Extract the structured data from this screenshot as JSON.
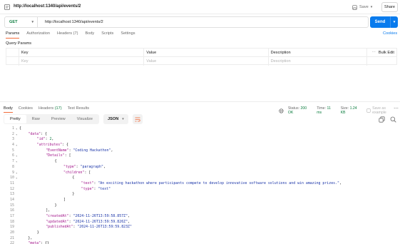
{
  "titlebar": {
    "title": "http://localhost:1340/api/events/2",
    "save_label": "Save",
    "share_label": "Share"
  },
  "request": {
    "method": "GET",
    "url": "http://localhost:1340/api/events/2",
    "send_label": "Send"
  },
  "request_tabs": [
    {
      "label": "Params",
      "active": true
    },
    {
      "label": "Authorization",
      "active": false
    },
    {
      "label": "Headers (7)",
      "active": false
    },
    {
      "label": "Body",
      "active": false
    },
    {
      "label": "Scripts",
      "active": false
    },
    {
      "label": "Settings",
      "active": false
    }
  ],
  "cookies_label": "Cookies",
  "query_params": {
    "title": "Query Params",
    "headers": {
      "key": "Key",
      "value": "Value",
      "description": "Description",
      "bulk_edit": "Bulk Edit"
    },
    "placeholder": {
      "key": "Key",
      "value": "Value",
      "description": "Description"
    }
  },
  "response": {
    "tabs": [
      {
        "label": "Body",
        "active": true
      },
      {
        "label": "Cookies",
        "active": false
      },
      {
        "label": "Headers",
        "count": "(17)",
        "active": false
      },
      {
        "label": "Test Results",
        "active": false
      }
    ],
    "status_label": "Status:",
    "status_value": "200 OK",
    "time_label": "Time:",
    "time_value": "11 ms",
    "size_label": "Size:",
    "size_value": "1.24 KB",
    "save_example": "Save as example"
  },
  "view": {
    "modes": [
      {
        "label": "Pretty",
        "active": true
      },
      {
        "label": "Raw",
        "active": false
      },
      {
        "label": "Preview",
        "active": false
      },
      {
        "label": "Visualize",
        "active": false
      }
    ],
    "format": "JSON"
  },
  "code_lines": [
    {
      "n": "1",
      "indent": 0,
      "fold": true,
      "tokens": [
        {
          "t": "p",
          "v": "{"
        }
      ]
    },
    {
      "n": "2",
      "indent": 1,
      "fold": true,
      "tokens": [
        {
          "t": "k",
          "v": "\"data\""
        },
        {
          "t": "p",
          "v": ": {"
        }
      ]
    },
    {
      "n": "3",
      "indent": 2,
      "tokens": [
        {
          "t": "k",
          "v": "\"id\""
        },
        {
          "t": "p",
          "v": ": "
        },
        {
          "t": "n",
          "v": "2"
        },
        {
          "t": "p",
          "v": ","
        }
      ]
    },
    {
      "n": "4",
      "indent": 2,
      "fold": true,
      "tokens": [
        {
          "t": "k",
          "v": "\"attributes\""
        },
        {
          "t": "p",
          "v": ": {"
        }
      ]
    },
    {
      "n": "5",
      "indent": 3,
      "tokens": [
        {
          "t": "k",
          "v": "\"EventName\""
        },
        {
          "t": "p",
          "v": ": "
        },
        {
          "t": "s",
          "v": "\"Coding Hackathon\""
        },
        {
          "t": "p",
          "v": ","
        }
      ]
    },
    {
      "n": "6",
      "indent": 3,
      "fold": true,
      "tokens": [
        {
          "t": "k",
          "v": "\"Details\""
        },
        {
          "t": "p",
          "v": ": ["
        }
      ]
    },
    {
      "n": "7",
      "indent": 4,
      "fold": true,
      "tokens": [
        {
          "t": "p",
          "v": "{"
        }
      ]
    },
    {
      "n": "8",
      "indent": 5,
      "tokens": [
        {
          "t": "k",
          "v": "\"type\""
        },
        {
          "t": "p",
          "v": ": "
        },
        {
          "t": "s",
          "v": "\"paragraph\""
        },
        {
          "t": "p",
          "v": ","
        }
      ]
    },
    {
      "n": "9",
      "indent": 5,
      "fold": true,
      "tokens": [
        {
          "t": "k",
          "v": "\"children\""
        },
        {
          "t": "p",
          "v": ": ["
        }
      ]
    },
    {
      "n": "10",
      "indent": 6,
      "fold": true,
      "tokens": [
        {
          "t": "p",
          "v": "{"
        }
      ]
    },
    {
      "n": "11",
      "indent": 7,
      "tokens": [
        {
          "t": "k",
          "v": "\"text\""
        },
        {
          "t": "p",
          "v": ": "
        },
        {
          "t": "s",
          "v": "\"An exciting hackathon where participants compete to develop innovative software solutions and win amazing prizes.\""
        },
        {
          "t": "p",
          "v": ","
        }
      ]
    },
    {
      "n": "12",
      "indent": 7,
      "tokens": [
        {
          "t": "k",
          "v": "\"type\""
        },
        {
          "t": "p",
          "v": ": "
        },
        {
          "t": "s",
          "v": "\"text\""
        }
      ]
    },
    {
      "n": "13",
      "indent": 6,
      "tokens": [
        {
          "t": "p",
          "v": "}"
        }
      ]
    },
    {
      "n": "14",
      "indent": 5,
      "tokens": [
        {
          "t": "p",
          "v": "]"
        }
      ]
    },
    {
      "n": "15",
      "indent": 4,
      "tokens": [
        {
          "t": "p",
          "v": "}"
        }
      ]
    },
    {
      "n": "16",
      "indent": 3,
      "tokens": [
        {
          "t": "p",
          "v": "],"
        }
      ]
    },
    {
      "n": "17",
      "indent": 3,
      "tokens": [
        {
          "t": "k",
          "v": "\"createdAt\""
        },
        {
          "t": "p",
          "v": ": "
        },
        {
          "t": "s",
          "v": "\"2024-11-26T13:59:58.857Z\""
        },
        {
          "t": "p",
          "v": ","
        }
      ]
    },
    {
      "n": "18",
      "indent": 3,
      "tokens": [
        {
          "t": "k",
          "v": "\"updatedAt\""
        },
        {
          "t": "p",
          "v": ": "
        },
        {
          "t": "s",
          "v": "\"2024-11-26T13:59:59.826Z\""
        },
        {
          "t": "p",
          "v": ","
        }
      ]
    },
    {
      "n": "19",
      "indent": 3,
      "tokens": [
        {
          "t": "k",
          "v": "\"publishedAt\""
        },
        {
          "t": "p",
          "v": ": "
        },
        {
          "t": "s",
          "v": "\"2024-11-26T13:59:59.823Z\""
        }
      ]
    },
    {
      "n": "20",
      "indent": 2,
      "tokens": [
        {
          "t": "p",
          "v": "}"
        }
      ]
    },
    {
      "n": "21",
      "indent": 1,
      "tokens": [
        {
          "t": "p",
          "v": "},"
        }
      ]
    },
    {
      "n": "22",
      "indent": 1,
      "tokens": [
        {
          "t": "k",
          "v": "\"meta\""
        },
        {
          "t": "p",
          "v": ": {}"
        }
      ]
    },
    {
      "n": "23",
      "indent": 0,
      "tokens": [
        {
          "t": "p",
          "v": "}"
        }
      ]
    }
  ]
}
